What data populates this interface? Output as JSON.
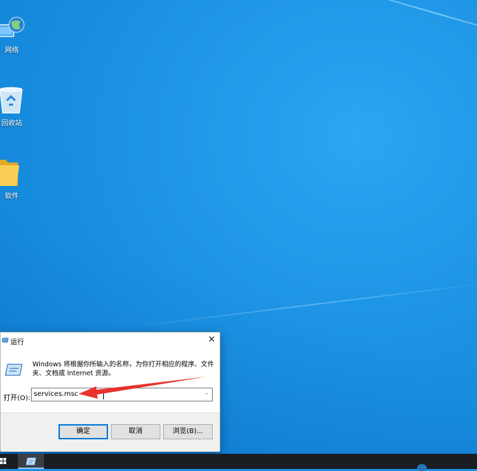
{
  "desktop": {
    "icons": [
      {
        "label": "网络",
        "icon": "network-icon"
      },
      {
        "label": "回收站",
        "icon": "recycle-bin-icon"
      },
      {
        "label": "软件",
        "icon": "folder-icon"
      }
    ]
  },
  "run_dialog": {
    "title": "运行",
    "close_glyph": "✕",
    "description": "Windows 将根据你所输入的名称，为你打开相应的程序、文件夹、文档或 Internet 资源。",
    "open_label": "打开(O):",
    "input_value": "services.msc",
    "buttons": {
      "ok": "确定",
      "cancel": "取消",
      "browse": "浏览(B)..."
    }
  },
  "colors": {
    "accent": "#0078d7",
    "annotation_arrow": "#e8322b",
    "taskbar": "#1a1d21"
  }
}
